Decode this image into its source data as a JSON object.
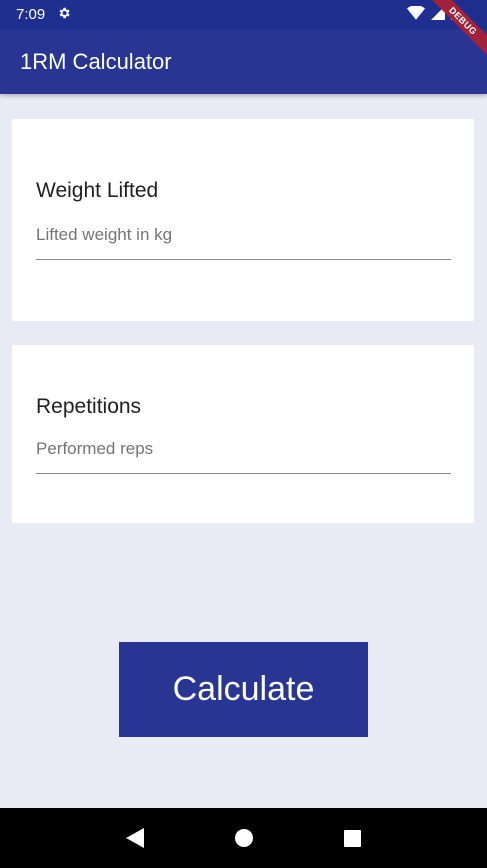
{
  "status_bar": {
    "time": "7:09",
    "icons": [
      "settings-icon",
      "wifi-icon",
      "signal-icon",
      "battery-icon"
    ]
  },
  "debug_banner": "DEBUG",
  "app_bar": {
    "title": "1RM Calculator"
  },
  "fields": {
    "weight": {
      "label": "Weight Lifted",
      "placeholder": "Lifted weight in kg",
      "value": ""
    },
    "reps": {
      "label": "Repetitions",
      "placeholder": "Performed reps",
      "value": ""
    }
  },
  "calculate_button": {
    "label": "Calculate"
  },
  "nav_bar": {
    "icons": [
      "back-icon",
      "home-icon",
      "recents-icon"
    ]
  },
  "colors": {
    "primary": "#283593",
    "status_bar": "#1f2f8f",
    "background": "#e8eaf6",
    "debug_banner": "#a2223a"
  }
}
